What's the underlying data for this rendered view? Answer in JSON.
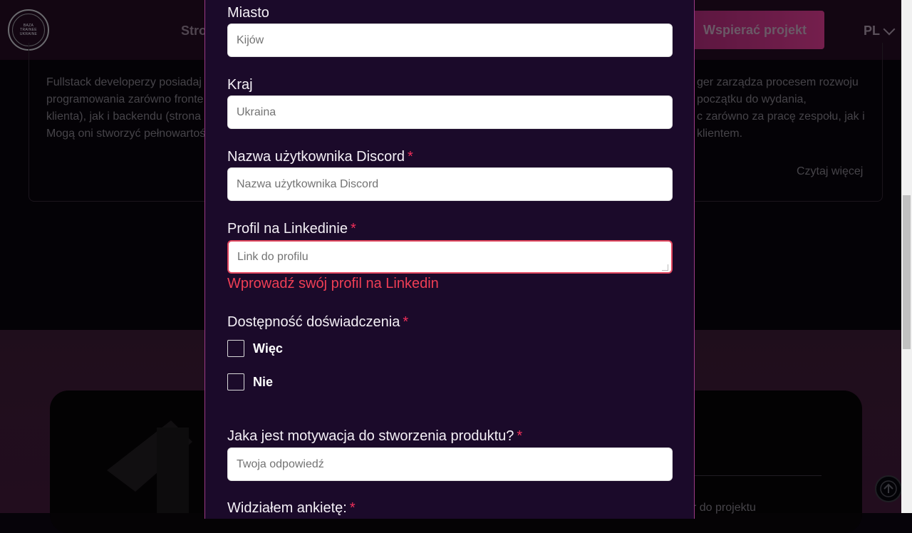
{
  "header": {
    "logo_lines": [
      "BAZA",
      "TRAINEE",
      "UKRAINE"
    ],
    "nav_partial": "Stro",
    "support_button": "Wspierać projekt",
    "language": "PL"
  },
  "background_cards": {
    "left_text": [
      "Fullstack developerzy posiadaj",
      "programowania zarówno fronte",
      "klienta), jak i backendu (strona",
      "Mogą oni stworzyć pełnowartoś"
    ],
    "right_text": [
      "ger zarządza procesem rozwoju",
      "początku do wydania,",
      "c zarówno za pracę zespołu, jak i",
      "klientem."
    ],
    "read_more": "Czytaj więcej",
    "bottom_partial": "r do projektu"
  },
  "form": {
    "city": {
      "label": "Miasto",
      "placeholder": "Kijów"
    },
    "country": {
      "label": "Kraj",
      "placeholder": "Ukraina"
    },
    "discord": {
      "label": "Nazwa użytkownika Discord",
      "required": "*",
      "placeholder": "Nazwa użytkownika Discord"
    },
    "linkedin": {
      "label": "Profil na Linkedinie",
      "required": "*",
      "placeholder": "Link do profilu",
      "error": "Wprowadź swój profil na Linkedin"
    },
    "experience": {
      "label": "Dostępność doświadczenia",
      "required": "*",
      "options": [
        "Więc",
        "Nie"
      ]
    },
    "motivation": {
      "label": "Jaka jest motywacja do stworzenia produktu?",
      "required": "*",
      "placeholder": "Twoja odpowiedź"
    },
    "survey": {
      "label": "Widziałem ankietę:",
      "required": "*"
    }
  },
  "colors": {
    "modal_bg": "#1b0a2a",
    "required": "#ef2f5a",
    "error": "#ef3e55",
    "accent_pink": "#9c2a67"
  }
}
